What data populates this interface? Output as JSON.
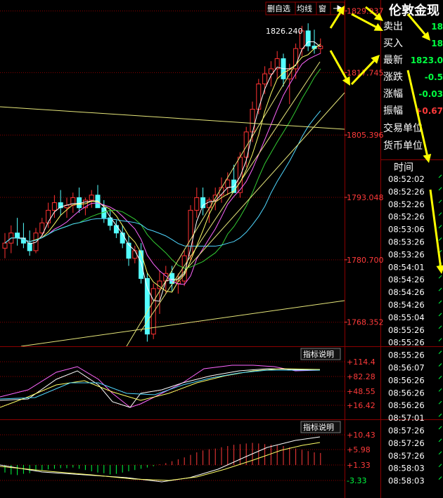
{
  "toolbar": {
    "del_select_label": "删自选",
    "ma_label": "均线",
    "window_label": "窗",
    "arrow_icon": "right-arrow-icon"
  },
  "quote_panel": {
    "title": "伦敦金现",
    "rows": [
      {
        "label": "卖出",
        "value": "18"
      },
      {
        "label": "买入",
        "value": "18"
      },
      {
        "label": "最新",
        "value": "1823.0"
      },
      {
        "label": "涨跌",
        "value": "-0.5"
      },
      {
        "label": "涨幅",
        "value": "-0.03"
      },
      {
        "label": "振幅",
        "value": "+0.67"
      },
      {
        "label": "交易单位",
        "value": ""
      },
      {
        "label": "货币单位",
        "value": ""
      }
    ],
    "time_header": "时间",
    "times": [
      "08:52:02",
      "08:52:26",
      "08:52:26",
      "08:52:26",
      "08:53:06",
      "08:53:26",
      "08:53:26",
      "08:54:01",
      "08:54:26",
      "08:54:26",
      "08:54:26",
      "08:55:04",
      "08:55:26",
      "08:55:26",
      "08:55:26",
      "08:56:07",
      "08:56:26",
      "08:56:26",
      "08:56:26",
      "08:57:01",
      "08:57:26",
      "08:57:26",
      "08:57:26",
      "08:58:03",
      "08:58:03"
    ]
  },
  "price_axis": {
    "ticks": [
      "1829.937",
      "1817.745",
      "1805.396",
      "1793.048",
      "1780.700",
      "1768.352"
    ],
    "price_high_label": "1826.240"
  },
  "indicator1": {
    "button": "指标说明",
    "ticks": [
      "+114.4",
      "+82.28",
      "+48.55",
      "+16.42"
    ]
  },
  "indicator2": {
    "button": "指标说明",
    "ticks": [
      "+10.43",
      "+5.98",
      "+1.33",
      "-3.33"
    ]
  },
  "colors": {
    "background": "#000000",
    "up": "#ff3232",
    "down": "#54ffff",
    "grid": "#8b0000",
    "ma_yellow": "#ffff66",
    "ma_white": "#ffffff",
    "ma_purple": "#ff66ff",
    "ma_green": "#33cc33",
    "ma_cyan": "#4fd7ff",
    "trend": "#e6e67a",
    "arrow": "#ffff00",
    "label_red": "#ff3a3a",
    "value_green": "#00ff40"
  },
  "chart_data": {
    "type": "candlestick",
    "ylim": [
      1764,
      1831
    ],
    "candles": [
      [
        1783.0,
        1786.0,
        1781.0,
        1784.0
      ],
      [
        1784.0,
        1787.5,
        1782.0,
        1786.0
      ],
      [
        1786.0,
        1789.0,
        1783.5,
        1785.0
      ],
      [
        1785.0,
        1788.0,
        1783.0,
        1784.0
      ],
      [
        1784.0,
        1786.5,
        1781.5,
        1782.5
      ],
      [
        1782.5,
        1787.0,
        1782.0,
        1786.0
      ],
      [
        1786.0,
        1789.0,
        1785.0,
        1788.0
      ],
      [
        1788.0,
        1792.0,
        1787.0,
        1790.5
      ],
      [
        1790.5,
        1793.5,
        1789.0,
        1792.0
      ],
      [
        1792.0,
        1794.5,
        1789.5,
        1791.0
      ],
      [
        1791.0,
        1793.0,
        1789.0,
        1791.5
      ],
      [
        1791.5,
        1794.0,
        1790.0,
        1793.0
      ],
      [
        1793.0,
        1795.0,
        1790.0,
        1791.0
      ],
      [
        1791.0,
        1793.0,
        1789.5,
        1792.5
      ],
      [
        1792.5,
        1794.5,
        1791.0,
        1793.5
      ],
      [
        1793.5,
        1795.5,
        1792.0,
        1791.0
      ],
      [
        1791.0,
        1792.5,
        1788.0,
        1789.0
      ],
      [
        1789.0,
        1790.5,
        1786.5,
        1787.5
      ],
      [
        1787.5,
        1788.5,
        1785.0,
        1786.0
      ],
      [
        1786.0,
        1787.5,
        1783.0,
        1784.0
      ],
      [
        1784.0,
        1785.5,
        1779.5,
        1781.0
      ],
      [
        1781.0,
        1783.5,
        1780.0,
        1782.5
      ],
      [
        1782.5,
        1784.0,
        1776.0,
        1777.0
      ],
      [
        1777.0,
        1778.0,
        1764.5,
        1766.0
      ],
      [
        1766.0,
        1776.0,
        1765.0,
        1775.0
      ],
      [
        1775.0,
        1778.5,
        1770.0,
        1776.5
      ],
      [
        1776.5,
        1779.5,
        1774.0,
        1778.0
      ],
      [
        1778.0,
        1779.5,
        1774.5,
        1776.0
      ],
      [
        1776.0,
        1778.0,
        1774.0,
        1776.5
      ],
      [
        1776.5,
        1782.5,
        1775.5,
        1781.5
      ],
      [
        1781.5,
        1791.5,
        1780.5,
        1790.5
      ],
      [
        1790.5,
        1795.0,
        1789.0,
        1793.0
      ],
      [
        1793.0,
        1795.0,
        1789.5,
        1791.0
      ],
      [
        1791.0,
        1793.0,
        1788.0,
        1792.5
      ],
      [
        1792.5,
        1795.0,
        1790.5,
        1793.5
      ],
      [
        1793.5,
        1797.0,
        1792.0,
        1795.0
      ],
      [
        1795.0,
        1798.0,
        1793.5,
        1796.5
      ],
      [
        1796.5,
        1799.5,
        1794.5,
        1794.0
      ],
      [
        1794.0,
        1802.0,
        1793.0,
        1801.0
      ],
      [
        1801.0,
        1807.0,
        1799.0,
        1806.0
      ],
      [
        1806.0,
        1812.0,
        1804.0,
        1810.5
      ],
      [
        1810.5,
        1816.5,
        1809.5,
        1815.5
      ],
      [
        1815.5,
        1819.0,
        1813.5,
        1817.5
      ],
      [
        1817.5,
        1820.0,
        1815.0,
        1818.5
      ],
      [
        1818.5,
        1822.0,
        1816.5,
        1820.5
      ],
      [
        1820.5,
        1821.5,
        1815.0,
        1816.5
      ],
      [
        1816.5,
        1819.5,
        1811.5,
        1818.5
      ],
      [
        1818.5,
        1823.5,
        1816.5,
        1822.5
      ],
      [
        1822.5,
        1827.0,
        1821.0,
        1826.0
      ],
      [
        1826.0,
        1827.5,
        1822.0,
        1823.0
      ],
      [
        1823.0,
        1826.24,
        1821.5,
        1822.5
      ],
      [
        1822.5,
        1824.5,
        1821.5,
        1823.0
      ]
    ]
  }
}
